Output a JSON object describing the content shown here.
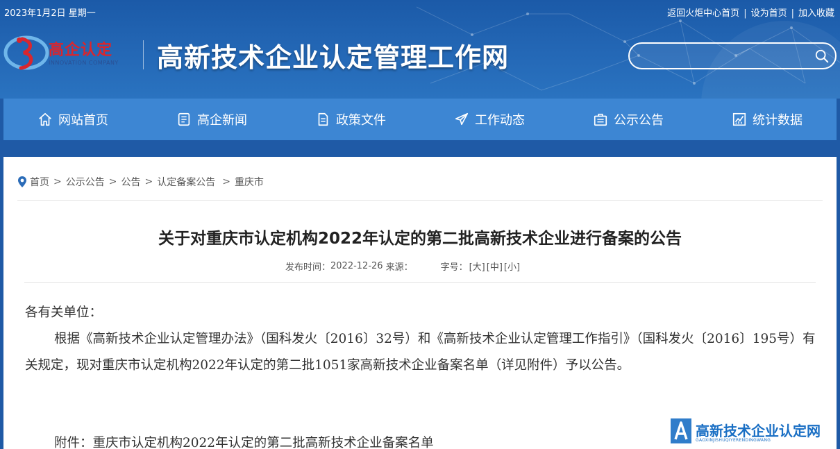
{
  "topbar": {
    "date": "2023年1月2日 星期一",
    "links": [
      "返回火炬中心首页",
      "设为首页",
      "加入收藏"
    ],
    "separator": "|"
  },
  "logo": {
    "cn": "高企认定",
    "en": "INNOVATION COMPANY"
  },
  "site_title": "高新技术企业认定管理工作网",
  "search": {
    "placeholder": "",
    "icon": "search-icon"
  },
  "nav": [
    {
      "label": "网站首页",
      "icon": "home-icon"
    },
    {
      "label": "高企新闻",
      "icon": "news-icon"
    },
    {
      "label": "政策文件",
      "icon": "document-icon"
    },
    {
      "label": "工作动态",
      "icon": "paper-plane-icon"
    },
    {
      "label": "公示公告",
      "icon": "notice-icon"
    },
    {
      "label": "统计数据",
      "icon": "chart-icon"
    }
  ],
  "breadcrumb": {
    "items": [
      "首页",
      "公示公告",
      "公告",
      "认定备案公告",
      "重庆市"
    ],
    "separator": ">"
  },
  "article": {
    "title": "关于对重庆市认定机构2022年认定的第二批高新技术企业进行备案的公告",
    "meta": {
      "publish_label": "发布时间：",
      "publish_date": "2022-12-26",
      "source_label": "来源：",
      "fontsize_label": "字号：",
      "sizes": [
        "[大]",
        "[中]",
        "[小]"
      ]
    },
    "salutation": "各有关单位：",
    "paragraph": "根据《高新技术企业认定管理办法》（国科发火〔2016〕32号）和《高新技术企业认定管理工作指引》（国科发火〔2016〕195号）有关规定，现对重庆市认定机构2022年认定的第二批1051家高新技术企业备案名单（详见附件）予以公告。",
    "attachment": "附件：重庆市认定机构2022年认定的第二批高新技术企业备案名单"
  },
  "watermark": {
    "cn": "高新技术企业认定网",
    "en": "GAOXINJISHUQIYERENDINGWANG"
  },
  "colors": {
    "header_bg": "#1f5aa6",
    "nav_bg": "#3d86d3",
    "logo_red": "#d9262e",
    "watermark_blue": "#1a6fc4"
  }
}
